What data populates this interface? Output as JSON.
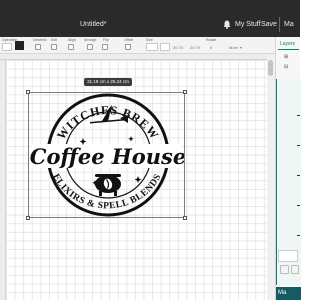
{
  "window": {
    "title": "Untitled*",
    "my_stuff": "My Stuff",
    "save": "Save",
    "more": "Ma"
  },
  "toolbar": {
    "operation_label": "Operation",
    "edit_label": "Edit",
    "align_label": "Align",
    "arrange_label": "Arrange",
    "flip_label": "Flip",
    "offset_label": "Offset",
    "size_label": "Size",
    "rotate_label": "Rotate",
    "more_label": "More",
    "w_value": "20.79",
    "h_value": "20.79",
    "position_value": "0"
  },
  "canvas": {
    "dimensions": "31.18 cm x 25.24 cm"
  },
  "design": {
    "top_text": "WITCHES BREW",
    "middle_text": "Coffee House",
    "bottom_text": "ELIXIRS & SPELL BLENDS"
  },
  "panel": {
    "tab_label": "Layers",
    "make_label": "Ma"
  },
  "colors": {
    "titlebar": "#2a2a2a",
    "accent": "#0e7a77",
    "make_button": "#155b61"
  }
}
